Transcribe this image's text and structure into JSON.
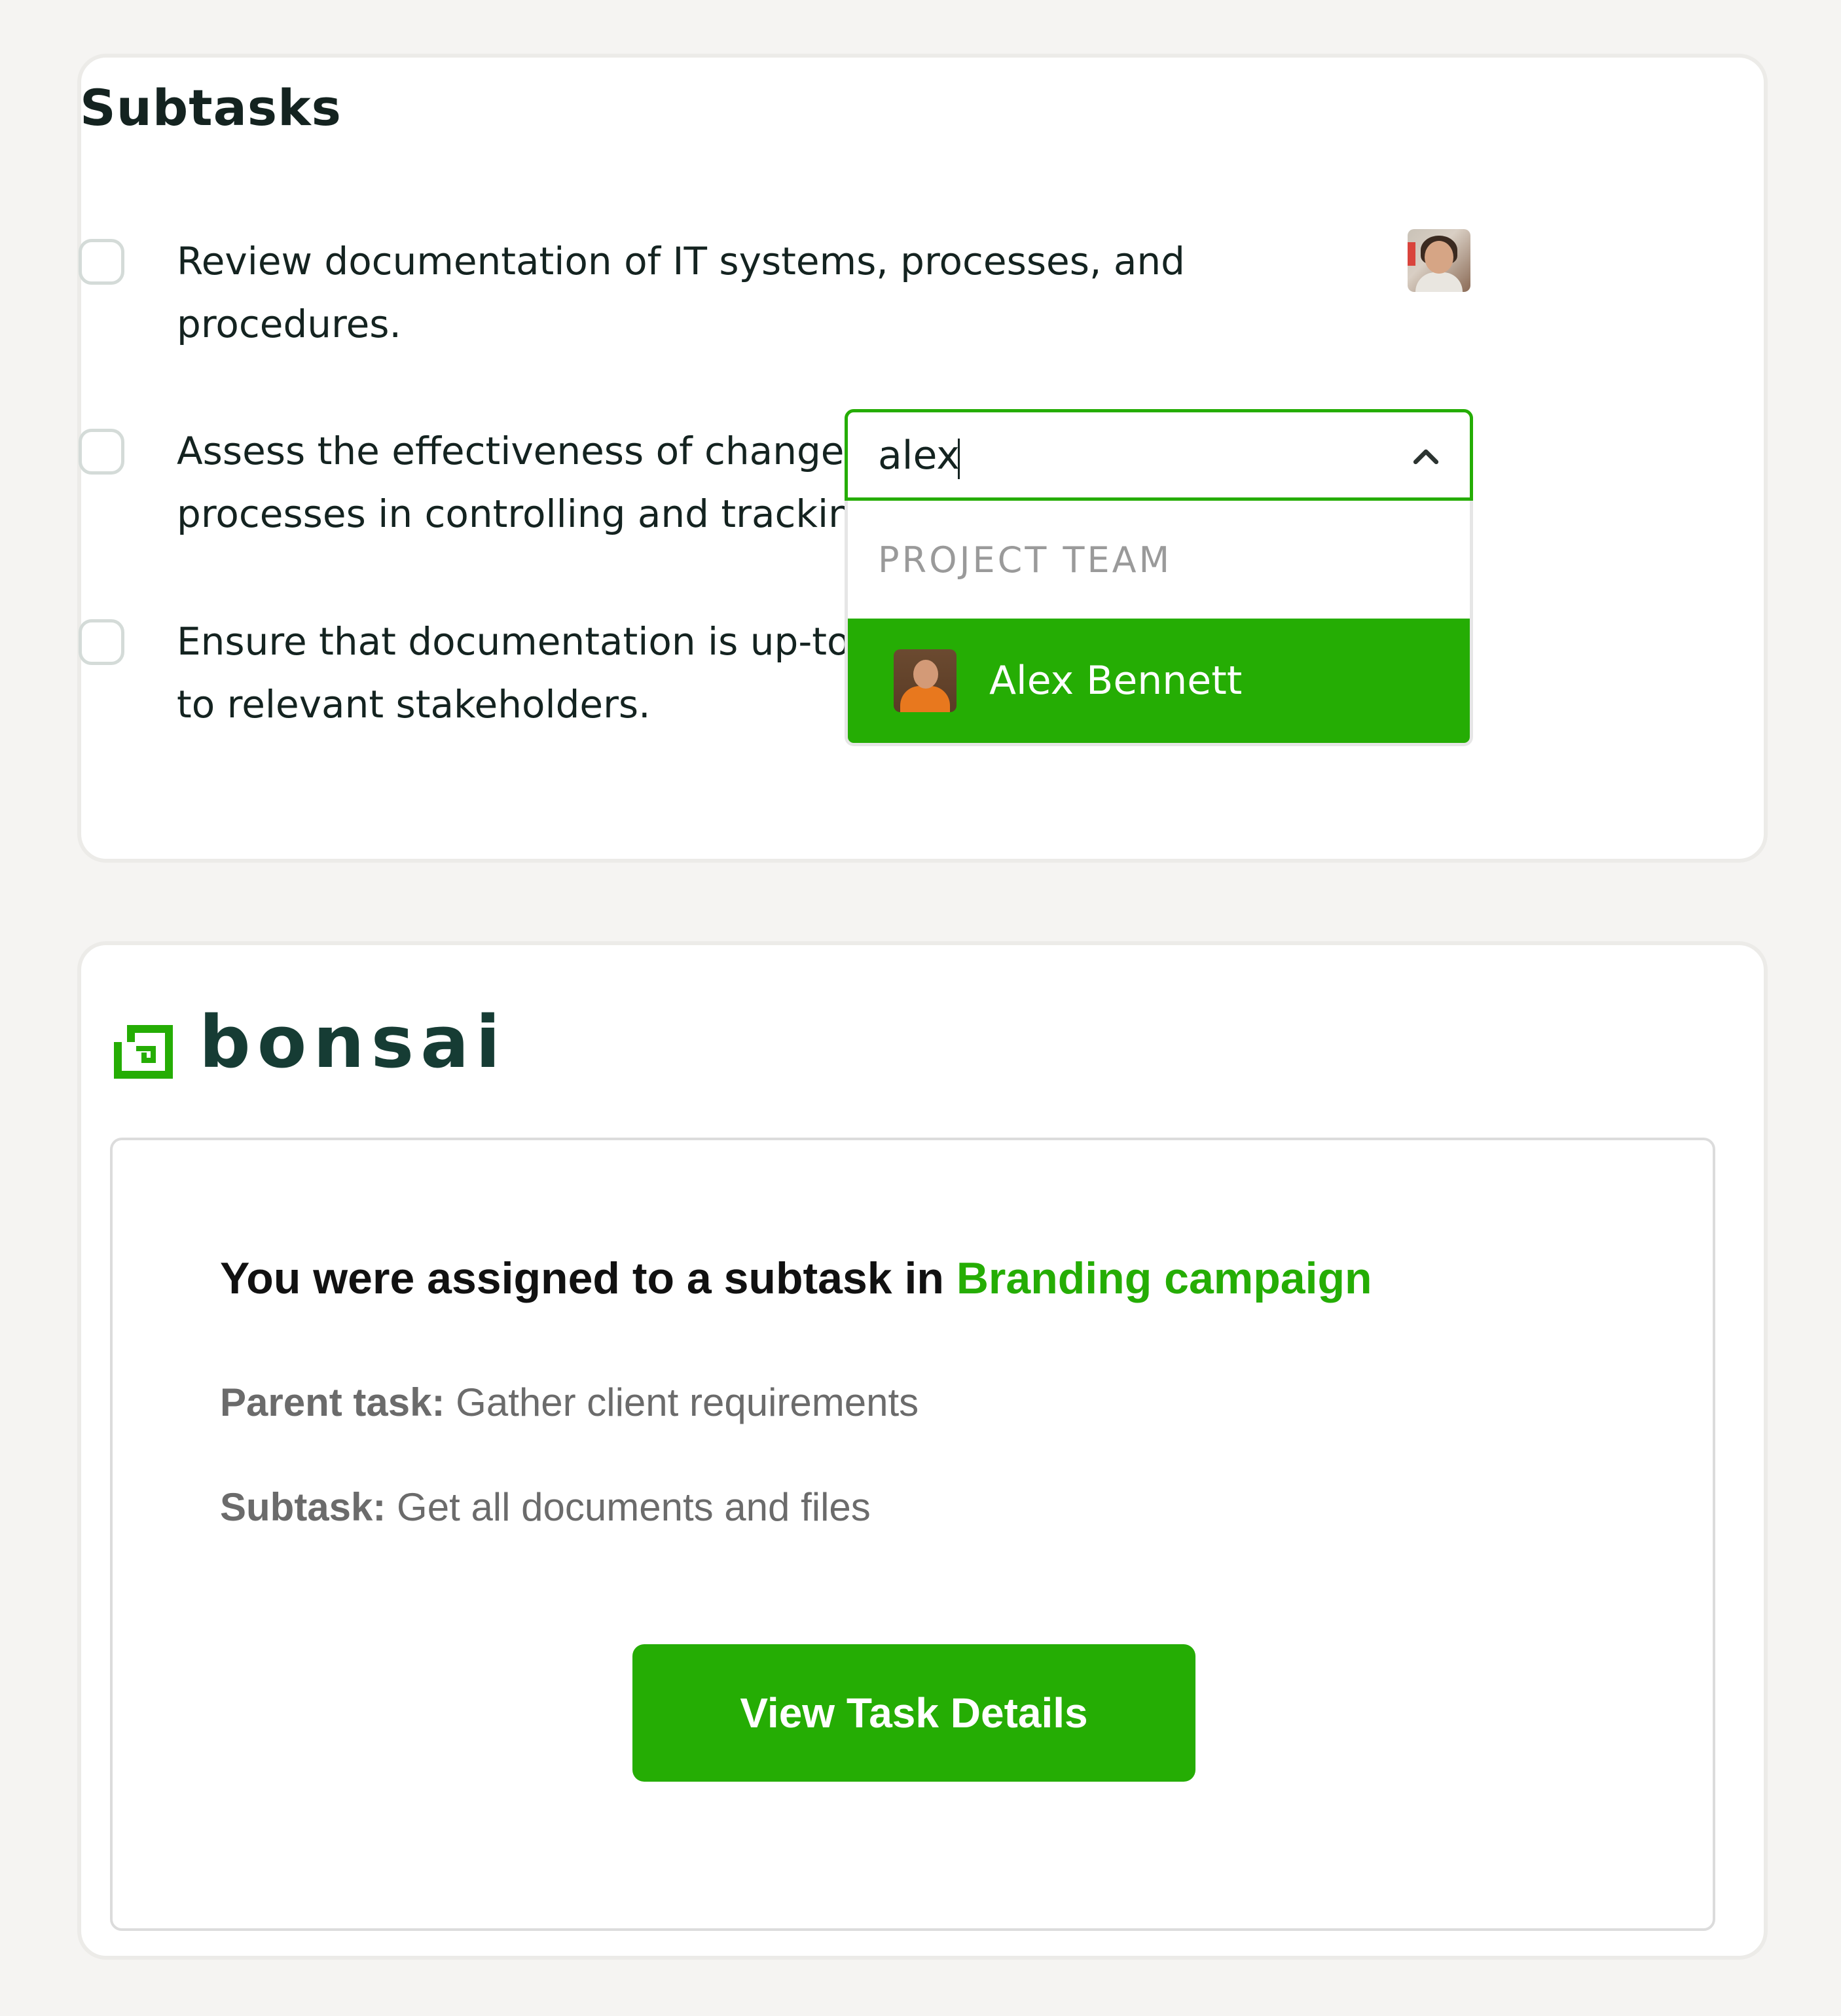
{
  "subtasks_card": {
    "title": "Subtasks",
    "items": [
      {
        "text": "Review documentation of IT systems, processes, and procedures."
      },
      {
        "text": "Assess the effectiveness of change management processes in controlling and tracking changes."
      },
      {
        "text": "Ensure that documentation is up-to-date and accessible to relevant stakeholders."
      }
    ],
    "assignee_dropdown": {
      "search_value": "alex",
      "group_header": "PROJECT TEAM",
      "options": [
        {
          "label": "Alex Bennett",
          "highlighted": true
        }
      ]
    }
  },
  "email_card": {
    "brand": "bonsai",
    "heading_prefix": "You were assigned to a subtask in ",
    "project_link": "Branding campaign",
    "parent_task_label": "Parent task:",
    "parent_task_value": " Gather client requirements",
    "subtask_label": "Subtask:",
    "subtask_value": " Get all documents and files",
    "button_label": "View Task Details"
  },
  "colors": {
    "accent_green": "#25ad04",
    "brand_dark": "#163c34",
    "page_background": "#f5f4f2"
  },
  "icons": [
    "checkbox-icon",
    "chevron-up-icon",
    "bonsai-logo-icon"
  ]
}
